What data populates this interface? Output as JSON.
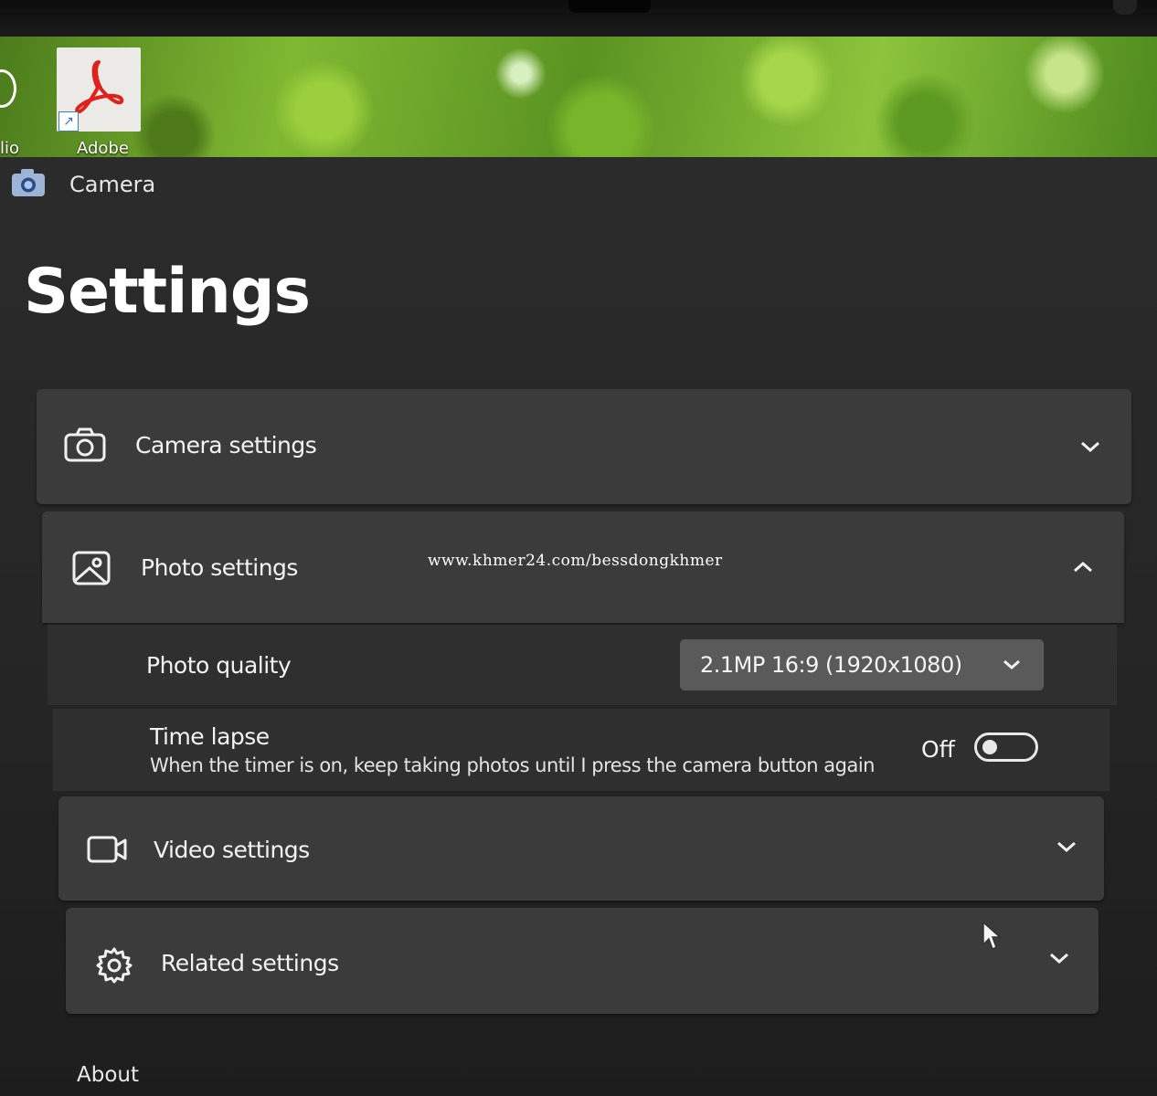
{
  "desktop": {
    "left_label": "lio",
    "shortcut_label": "Adobe",
    "shortcut_icon": "adobe-acrobat-icon"
  },
  "window": {
    "app_icon": "camera-icon",
    "app_title": "Camera"
  },
  "page": {
    "title": "Settings"
  },
  "sections": {
    "camera": {
      "label": "Camera settings",
      "icon": "camera-icon",
      "state": "collapsed"
    },
    "photo": {
      "label": "Photo settings",
      "icon": "photo-icon",
      "state": "expanded",
      "photo_quality": {
        "label": "Photo quality",
        "value": "2.1MP 16:9 (1920x1080)"
      },
      "time_lapse": {
        "label": "Time lapse",
        "description": "When the timer is on, keep taking photos until I press the camera button again",
        "state_label": "Off",
        "on": false
      }
    },
    "video": {
      "label": "Video settings",
      "icon": "video-camera-icon",
      "state": "collapsed"
    },
    "related": {
      "label": "Related settings",
      "icon": "gear-icon",
      "state": "collapsed"
    }
  },
  "about": {
    "label": "About"
  },
  "watermark": "www.khmer24.com/bessdongkhmer",
  "colors": {
    "card_bg": "#3b3b3b",
    "sub_row_bg": "#2f2f2f",
    "dropdown_bg": "#5a5a5a",
    "app_bg": "#262626"
  }
}
